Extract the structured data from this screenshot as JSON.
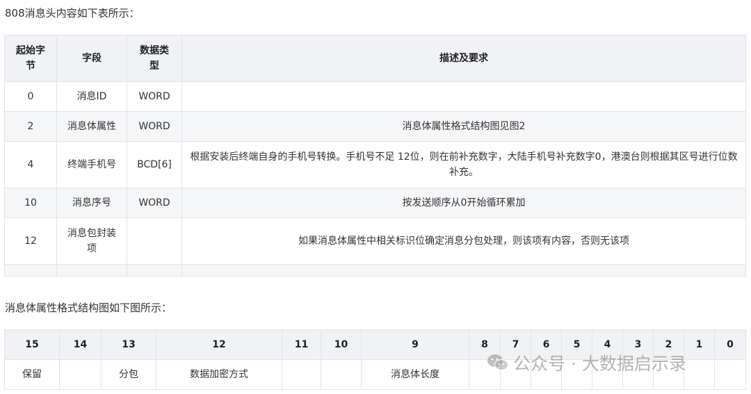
{
  "heading1": "808消息头内容如下表所示：",
  "table1": {
    "headers": [
      "起始字\n节",
      "字段",
      "数据类\n型",
      "描述及要求"
    ],
    "rows": [
      [
        "0",
        "消息ID",
        "WORD",
        ""
      ],
      [
        "2",
        "消息体属性",
        "WORD",
        "消息体属性格式结构图见图2"
      ],
      [
        "4",
        "终端手机号",
        "BCD[6]",
        "根据安装后终端自身的手机号转换。手机号不足 12位，则在前补充数字，大陆手机号补充数字0，港澳台则根据其区号进行位数补充。"
      ],
      [
        "10",
        "消息序号",
        "WORD",
        "按发送顺序从0开始循环累加"
      ],
      [
        "12",
        "消息包封装项",
        "",
        "如果消息体属性中相关标识位确定消息分包处理，则该项有内容，否则无该项"
      ]
    ]
  },
  "heading2": "消息体属性格式结构图如下图所示：",
  "table2": {
    "bits": [
      "15",
      "14",
      "13",
      "12",
      "11",
      "10",
      "9",
      "8",
      "7",
      "6",
      "5",
      "4",
      "3",
      "2",
      "1",
      "0"
    ],
    "fields": {
      "b15": "保留",
      "b14": "",
      "b13": "分包",
      "b12": "数据加密方式",
      "b11": "",
      "b10": "",
      "b9": "消息体长度"
    }
  },
  "watermark": {
    "text": "公众号 · 大数据启示录",
    "icon": "wechat-icon"
  }
}
